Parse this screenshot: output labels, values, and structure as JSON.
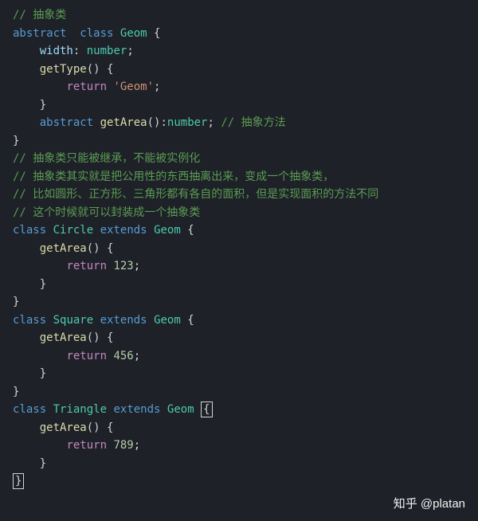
{
  "code": {
    "l1": {
      "c": "// 抽象类"
    },
    "l2": {
      "abstract": "abstract",
      "classkw": "class",
      "cname": "Geom",
      "open": "{"
    },
    "l3": {
      "prop": "width",
      "colon": ":",
      "type": "number",
      "semi": ";"
    },
    "l4": {
      "method": "getType",
      "parens": "()",
      "open": "{"
    },
    "l5": {
      "ret": "return",
      "str": "'Geom'",
      "semi": ";"
    },
    "l6": {
      "close": "}"
    },
    "l7": {
      "abstract": "abstract",
      "method": "getArea",
      "parens": "()",
      "colon": ":",
      "type": "number",
      "semi": ";",
      "c": " // 抽象方法"
    },
    "l8": {
      "close": "}"
    },
    "l9": {
      "c": "// 抽象类只能被继承，不能被实例化"
    },
    "l10": {
      "c": "// 抽象类其实就是把公用性的东西抽离出来，变成一个抽象类，"
    },
    "l11": {
      "c": "// 比如圆形、正方形、三角形都有各自的面积，但是实现面积的方法不同"
    },
    "l12": {
      "c": "// 这个时候就可以封装成一个抽象类"
    },
    "l13": {
      "classkw": "class",
      "cname": "Circle",
      "extends": "extends",
      "sup": "Geom",
      "open": "{"
    },
    "l14": {
      "method": "getArea",
      "parens": "()",
      "open": "{"
    },
    "l15": {
      "ret": "return",
      "num": "123",
      "semi": ";"
    },
    "l16": {
      "close": "}"
    },
    "l17": {
      "close": "}"
    },
    "l18": {
      "classkw": "class",
      "cname": "Square",
      "extends": "extends",
      "sup": "Geom",
      "open": "{"
    },
    "l19": {
      "method": "getArea",
      "parens": "()",
      "open": "{"
    },
    "l20": {
      "ret": "return",
      "num": "456",
      "semi": ";"
    },
    "l21": {
      "close": "}"
    },
    "l22": {
      "close": "}"
    },
    "l23": {
      "classkw": "class",
      "cname": "Triangle",
      "extends": "extends",
      "sup": "Geom",
      "open": "{"
    },
    "l24": {
      "method": "getArea",
      "parens": "()",
      "open": "{"
    },
    "l25": {
      "ret": "return",
      "num": "789",
      "semi": ";"
    },
    "l26": {
      "close": "}"
    },
    "l27": {
      "close": "}"
    }
  },
  "watermark": "知乎 @platan",
  "chart_data": {
    "type": "table",
    "title": "TypeScript abstract class code snippet",
    "language": "typescript",
    "classes": [
      {
        "name": "Geom",
        "kind": "abstract",
        "members": [
          "width: number",
          "getType(): string -> 'Geom'",
          "abstract getArea(): number"
        ]
      },
      {
        "name": "Circle",
        "extends": "Geom",
        "getArea_return": 123
      },
      {
        "name": "Square",
        "extends": "Geom",
        "getArea_return": 456
      },
      {
        "name": "Triangle",
        "extends": "Geom",
        "getArea_return": 789
      }
    ],
    "comments": [
      "抽象类",
      "抽象方法",
      "抽象类只能被继承，不能被实例化",
      "抽象类其实就是把公用性的东西抽离出来，变成一个抽象类，",
      "比如圆形、正方形、三角形都有各自的面积，但是实现面积的方法不同",
      "这个时候就可以封装成一个抽象类"
    ]
  }
}
